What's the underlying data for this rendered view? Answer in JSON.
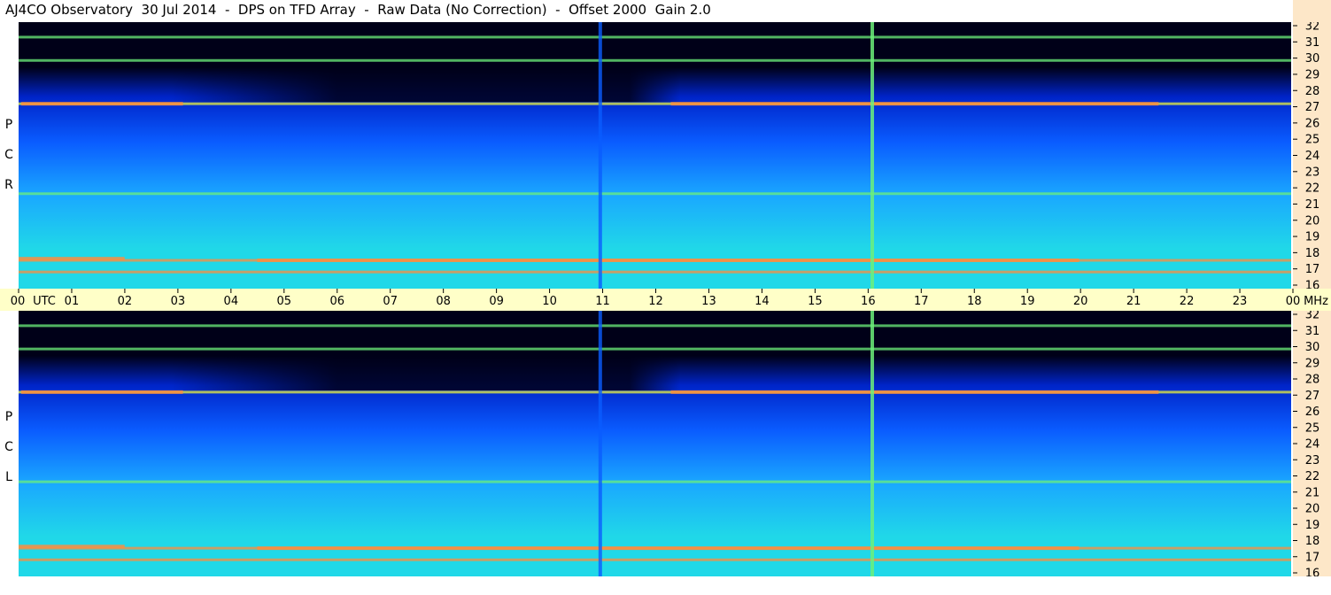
{
  "title": "AJ4CO Observatory  30 Jul 2014  -  DPS on TFD Array  -  Raw Data (No Correction)  -  Offset 2000  Gain 2.0",
  "panels": [
    {
      "polarization": "RCP",
      "letters": [
        "P",
        "C",
        "R"
      ]
    },
    {
      "polarization": "LCP",
      "letters": [
        "P",
        "C",
        "L"
      ]
    }
  ],
  "chart_data": {
    "type": "heatmap",
    "title": "AJ4CO Observatory  30 Jul 2014  -  DPS on TFD Array  -  Raw Data (No Correction)  -  Offset 2000  Gain 2.0",
    "x_axis": {
      "unit_label": "UTC",
      "range_hours": [
        0,
        24
      ],
      "tick_labels": [
        "00",
        "01",
        "02",
        "03",
        "04",
        "05",
        "06",
        "07",
        "08",
        "09",
        "10",
        "11",
        "12",
        "13",
        "14",
        "15",
        "16",
        "17",
        "18",
        "19",
        "20",
        "21",
        "22",
        "23",
        "00"
      ]
    },
    "y_axis": {
      "unit_label": "MHz",
      "range": [
        16,
        32
      ],
      "tick_labels": [
        "32",
        "31",
        "30",
        "29",
        "28",
        "27",
        "26",
        "25",
        "24",
        "23",
        "22",
        "21",
        "20",
        "19",
        "18",
        "17",
        "16"
      ]
    },
    "colormap": [
      "#000018",
      "#000a5a",
      "#0024c8",
      "#0a5cff",
      "#1aa8ff",
      "#20d8e8",
      "#6cf07a",
      "#e8f03c",
      "#ff8c3c",
      "#ff3c78"
    ],
    "persistent_signals_mhz": [
      17.0,
      17.7,
      21.7,
      27.1,
      29.7,
      31.1
    ],
    "broadband_events_utc": [
      10.97,
      16.1
    ]
  }
}
